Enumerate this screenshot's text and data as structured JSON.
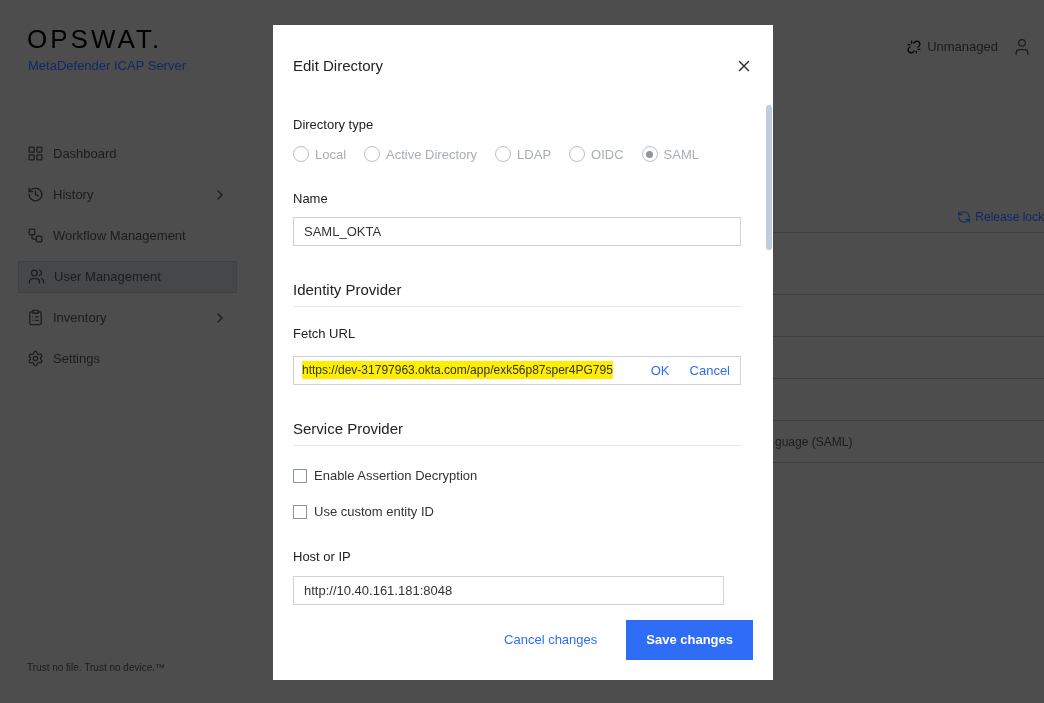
{
  "brand": {
    "logo": "OPSWAT.",
    "product": "MetaDefender ICAP Server"
  },
  "header": {
    "status": "Unmanaged"
  },
  "sidebar": {
    "items": [
      {
        "label": "Dashboard",
        "kind": "grid",
        "selected": false,
        "expandable": false
      },
      {
        "label": "History",
        "kind": "history",
        "selected": false,
        "expandable": true
      },
      {
        "label": "Workflow Management",
        "kind": "workflow",
        "selected": false,
        "expandable": false
      },
      {
        "label": "User Management",
        "kind": "users",
        "selected": true,
        "expandable": false
      },
      {
        "label": "Inventory",
        "kind": "clipboard",
        "selected": false,
        "expandable": true
      },
      {
        "label": "Settings",
        "kind": "gear",
        "selected": false,
        "expandable": false
      }
    ],
    "footer": "Trust no file. Trust no device.™"
  },
  "content": {
    "release_lock": "Release lock",
    "rows": [
      "",
      "",
      "",
      "",
      "guage (SAML)"
    ]
  },
  "dialog": {
    "title": "Edit Directory",
    "directory_type": {
      "label": "Directory type",
      "disabled": true,
      "options": [
        {
          "label": "Local",
          "selected": false
        },
        {
          "label": "Active Directory",
          "selected": false
        },
        {
          "label": "LDAP",
          "selected": false
        },
        {
          "label": "OIDC",
          "selected": false
        },
        {
          "label": "SAML",
          "selected": true
        }
      ]
    },
    "name": {
      "label": "Name",
      "value": "SAML_OKTA"
    },
    "identity_provider": {
      "heading": "Identity Provider",
      "fetch_url": {
        "label": "Fetch URL",
        "value": "https://dev-31797963.okta.com/app/exk56p87sper4PG795",
        "highlighted": true,
        "ok": "OK",
        "cancel": "Cancel"
      }
    },
    "service_provider": {
      "heading": "Service Provider",
      "checkboxes": [
        {
          "label": "Enable Assertion Decryption",
          "checked": false
        },
        {
          "label": "Use custom entity ID",
          "checked": false
        }
      ],
      "host": {
        "label": "Host or IP",
        "value": "http://10.40.161.181:8048"
      }
    },
    "buttons": {
      "cancel": "Cancel changes",
      "save": "Save changes"
    }
  }
}
